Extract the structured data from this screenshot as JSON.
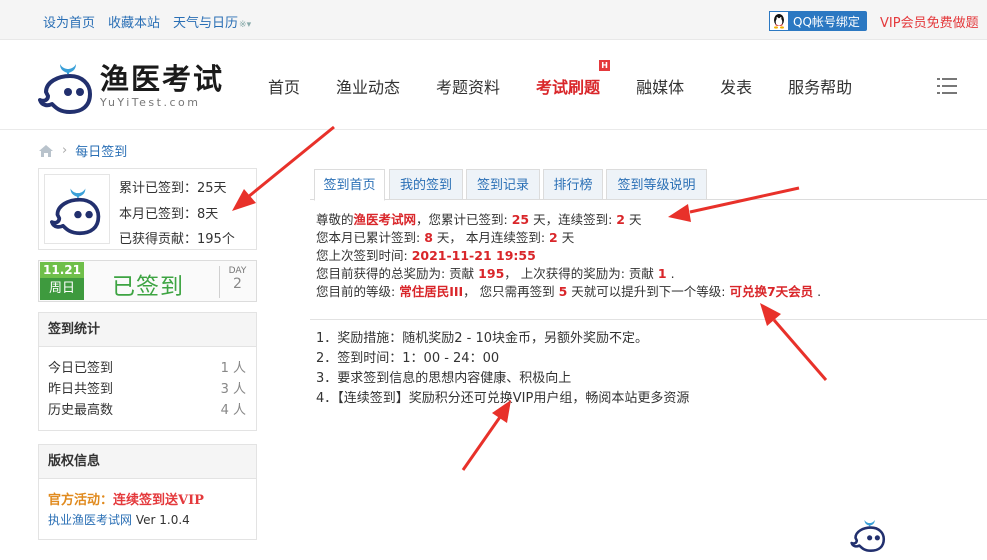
{
  "topbar": {
    "links": [
      "设为首页",
      "收藏本站",
      "天气与日历"
    ],
    "qq_label": "QQ帐号绑定",
    "vip_label": "VIP会员免费做题"
  },
  "logo": {
    "cn": "渔医考试",
    "en": "YuYiTest.com"
  },
  "nav": {
    "items": [
      "首页",
      "渔业动态",
      "考题资料",
      "考试刷题",
      "融媒体",
      "发表",
      "服务帮助"
    ],
    "active_index": 3,
    "hot_badge": "H"
  },
  "breadcrumb": {
    "current": "每日签到"
  },
  "profile": {
    "total_label": "累计已签到：",
    "total_value": "25天",
    "month_label": "本月已签到：",
    "month_value": "8天",
    "contrib_label": "已获得贡献：",
    "contrib_value": "195个"
  },
  "signed": {
    "date": "11.21",
    "weekday": "周日",
    "status": "已签到",
    "day_label": "DAY",
    "day_value": "2"
  },
  "stats_panel": {
    "title": "签到统计",
    "rows": [
      {
        "label": "今日已签到",
        "value": "1 人"
      },
      {
        "label": "昨日共签到",
        "value": "3 人"
      },
      {
        "label": "历史最高数",
        "value": "4 人"
      }
    ]
  },
  "copyright_panel": {
    "title": "版权信息",
    "promo_label": "官方活动：",
    "promo_text": "连续签到送VIP",
    "copy_link": "执业渔医考试网",
    "copy_version": " Ver 1.0.4"
  },
  "tabs": [
    "签到首页",
    "我的签到",
    "签到记录",
    "排行榜",
    "签到等级说明"
  ],
  "info": {
    "l1": {
      "a": "尊敬的",
      "site": "渔医考试网",
      "b": "，您累计已签到: ",
      "v1": "25",
      "c": " 天，连续签到: ",
      "v2": "2",
      "d": " 天"
    },
    "l2": {
      "a": "您本月已累计签到: ",
      "v1": "8",
      "b": " 天， 本月连续签到: ",
      "v2": "2",
      "c": " 天"
    },
    "l3": {
      "a": "您上次签到时间: ",
      "v": "2021-11-21 19:55"
    },
    "l4": {
      "a": "您目前获得的总奖励为: 贡献 ",
      "v1": "195",
      "b": "， 上次获得的奖励为: 贡献 ",
      "v2": "1",
      "c": " ."
    },
    "l5": {
      "a": "您目前的等级: ",
      "level": "常住居民III",
      "b": "， 您只需再签到 ",
      "v": "5",
      "c": " 天就可以提升到下一个等级: ",
      "next": "可兑换7天会员",
      "d": " ."
    }
  },
  "rules": [
    "1．奖励措施：随机奖励2 - 10块金币，另额外奖励不定。",
    "2．签到时间：1：00 - 24：00",
    "3．要求签到信息的思想内容健康、积极向上",
    "4．【连续签到】奖励积分还可兑换VIP用户组，畅阅本站更多资源"
  ],
  "colors": {
    "brand_blue": "#2a6fb5",
    "accent_red": "#d9262a",
    "signed_green": "#3ea443",
    "annotation_red": "#e8312a"
  },
  "icons": [
    "qq-penguin-icon",
    "dropdown-caret-icon",
    "home-icon",
    "menu-lines-icon",
    "whale-logo-icon"
  ]
}
